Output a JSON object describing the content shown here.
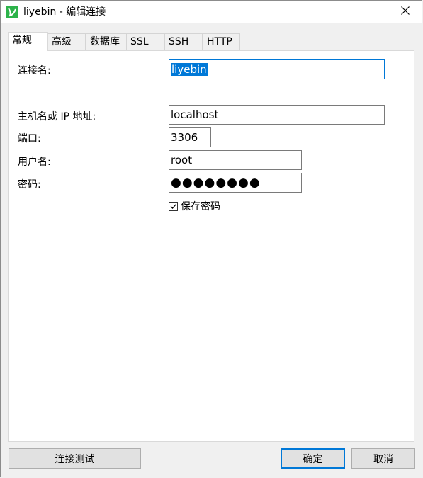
{
  "window": {
    "title": "liyebin - 编辑连接",
    "app_icon": "navicat-icon",
    "close_icon": "close-icon"
  },
  "tabs": [
    {
      "label": "常规",
      "active": true
    },
    {
      "label": "高级",
      "active": false
    },
    {
      "label": "数据库",
      "active": false
    },
    {
      "label": "SSL",
      "active": false
    },
    {
      "label": "SSH",
      "active": false
    },
    {
      "label": "HTTP",
      "active": false
    }
  ],
  "form": {
    "connection_name_label": "连接名:",
    "connection_name_value": "liyebin",
    "host_label": "主机名或 IP 地址:",
    "host_value": "localhost",
    "port_label": "端口:",
    "port_value": "3306",
    "user_label": "用户名:",
    "user_value": "root",
    "password_label": "密码:",
    "password_value": "●●●●●●●●",
    "save_password_label": "保存密码",
    "save_password_checked": true
  },
  "buttons": {
    "test_connection": "连接测试",
    "ok": "确定",
    "cancel": "取消"
  },
  "colors": {
    "accent": "#0078d7",
    "app_icon_green": "#2db34a"
  }
}
